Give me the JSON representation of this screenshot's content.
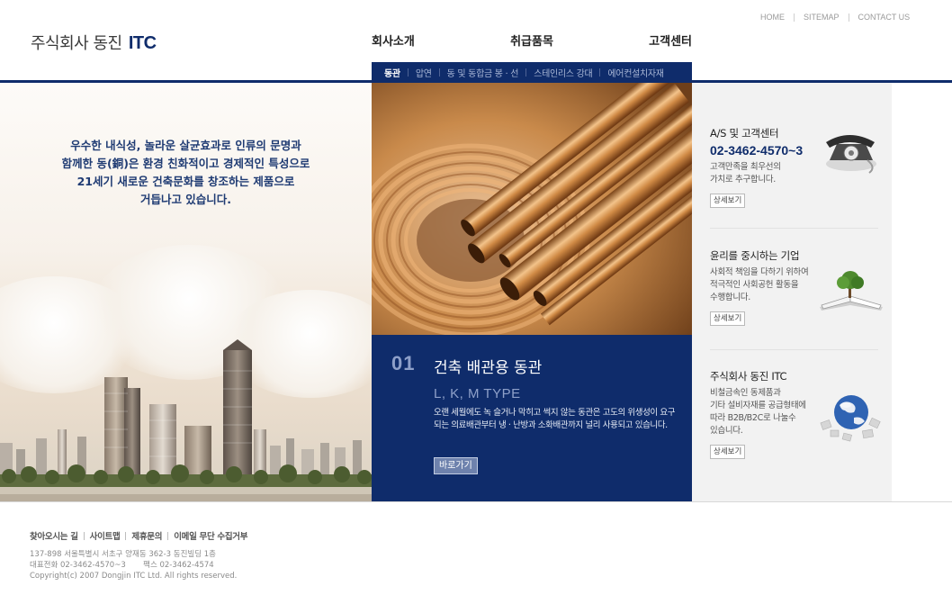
{
  "header": {
    "logo_text": "주식회사 동진",
    "logo_brand": "ITC",
    "util_links": [
      "HOME",
      "SITEMAP",
      "CONTACT US"
    ],
    "main_nav": [
      "회사소개",
      "취급품목",
      "고객센터"
    ],
    "sub_nav": [
      "동관",
      "압연",
      "동 및 동합금 봉 · 선",
      "스테인리스 강대",
      "에어컨설치자재"
    ],
    "sub_nav_active": "동관"
  },
  "hero": {
    "lines": [
      "우수한 내식성, 놀라운 살균효과로 인류의 문명과",
      "함께한 동(銅)은 환경 친화적이고 경제적인 특성으로",
      "21세기 새로운 건축문화를 창조하는 제품으로",
      "거듭나고 있습니다."
    ]
  },
  "feature": {
    "number": "01",
    "title": "건축 배관용 동관",
    "type": "L, K, M TYPE",
    "description": "오랜 세월에도 녹 슬거나 막히고 썩지 않는 동관은 고도의 위생성이 요구되는 의료배관부터 냉 · 난방과 소화배관까지 널리 사용되고 있습니다.",
    "button": "바로가기"
  },
  "sidebar": {
    "blocks": [
      {
        "title": "A/S 및 고객센터",
        "phone": "02-3462-4570~3",
        "text_lines": [
          "고객만족을 최우선의",
          "가치로 추구합니다."
        ],
        "button": "상세보기",
        "icon": "telephone-icon"
      },
      {
        "title": "윤리를 중시하는 기업",
        "text_lines": [
          "사회적 책임을 다하기 위하여",
          "적극적인 사회공헌 활동을",
          "수행합니다."
        ],
        "button": "상세보기",
        "icon": "book-tree-icon"
      },
      {
        "title": "주식회사 동진 ITC",
        "text_lines": [
          "비철금속인 동제품과",
          "기타 설비자재를 공급형태에",
          "따라 B2B/B2C로 나눌수",
          "있습니다."
        ],
        "button": "상세보기",
        "icon": "globe-icon"
      }
    ]
  },
  "footer": {
    "links": [
      "찾아오시는 길",
      "사이트맵",
      "제휴문의",
      "이메일 무단 수집거부"
    ],
    "address": "137-898 서울특별시 서초구 양재동 362-3 동진빌딩 1층",
    "phone": "대표전화 02-3462-4570~3",
    "fax": "팩스 02-3462-4574",
    "copyright": "Copyright(c) 2007 Dongjin ITC Ltd. All rights reserved."
  },
  "colors": {
    "brand_navy": "#0f2c6b",
    "sidebar_bg": "#f2f2f2",
    "copper": "#c98a4b"
  }
}
